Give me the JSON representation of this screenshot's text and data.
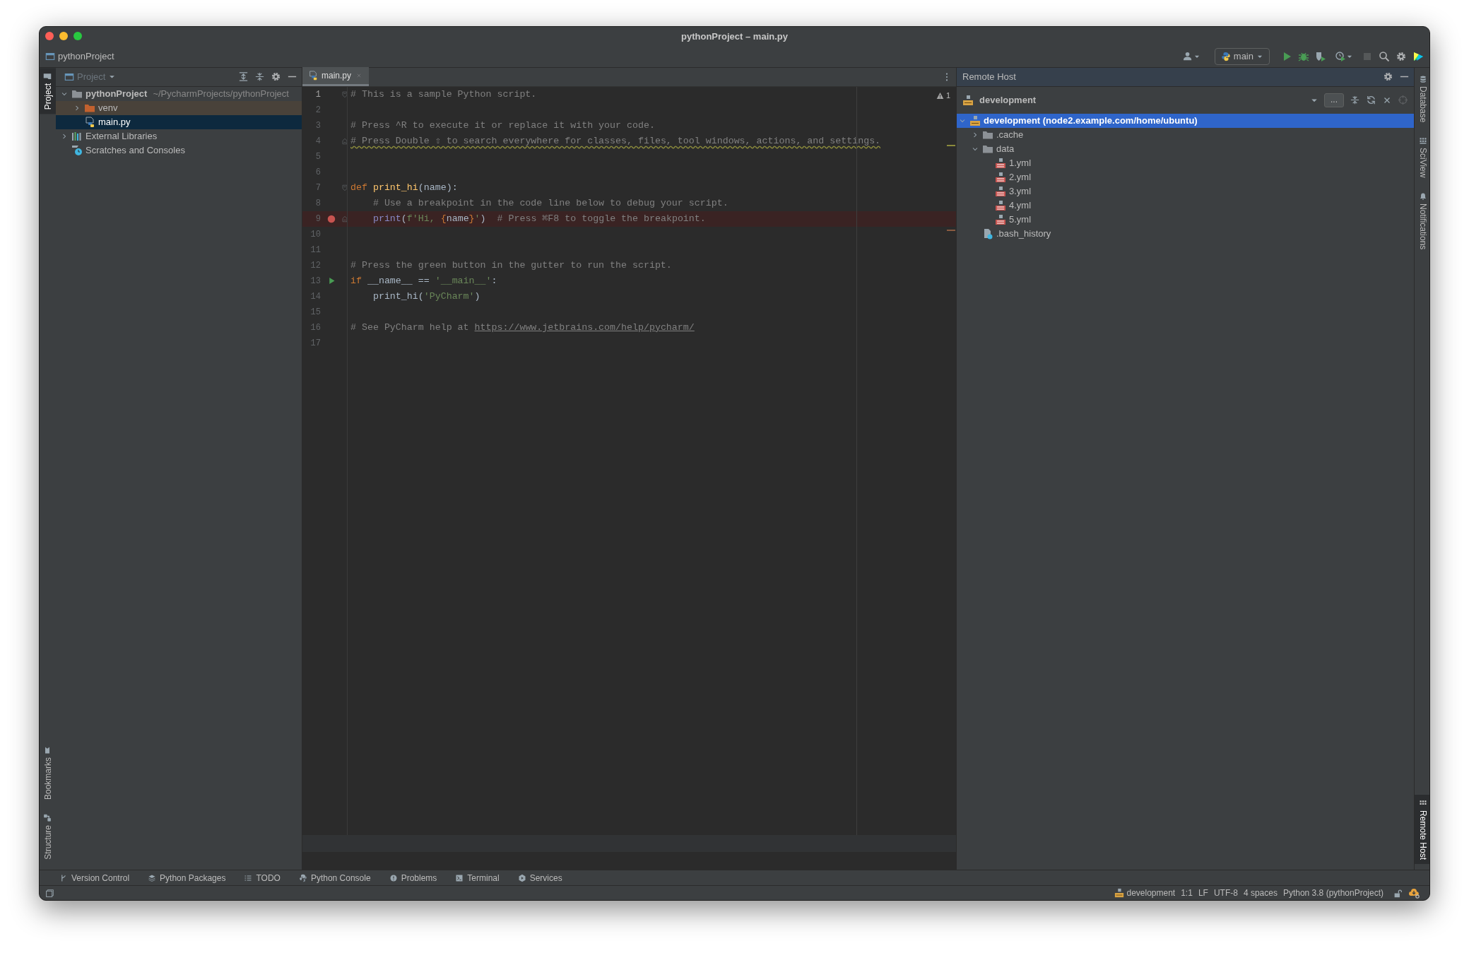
{
  "window": {
    "title": "pythonProject – main.py"
  },
  "navigation_bar": {
    "breadcrumb": "pythonProject",
    "run_configuration": "main",
    "stop_disabled": true
  },
  "left_stripe": {
    "top": [
      {
        "label": "Project",
        "selected": true
      }
    ],
    "bottom": [
      {
        "label": "Bookmarks",
        "selected": false
      },
      {
        "label": "Structure",
        "selected": false
      }
    ]
  },
  "project_panel": {
    "title": "Project",
    "tree": [
      {
        "label": "pythonProject",
        "detail": "~/PycharmProjects/pythonProject",
        "kind": "project_root",
        "expanded": true,
        "selected": false,
        "children": [
          {
            "label": "venv",
            "kind": "excluded_folder",
            "expanded": false,
            "selected": false
          },
          {
            "label": "main.py",
            "kind": "python_file",
            "selected": true
          }
        ]
      },
      {
        "label": "External Libraries",
        "kind": "libraries",
        "expanded": false,
        "selected": false
      },
      {
        "label": "Scratches and Consoles",
        "kind": "scratches",
        "selected": false
      }
    ]
  },
  "editor": {
    "tabs": [
      {
        "label": "main.py",
        "selected": true
      }
    ],
    "warning_count": "1",
    "lines": [
      {
        "number": "1",
        "breakpoint": false,
        "run_marker": false,
        "typo": false,
        "fold_start": true,
        "fold_end": false,
        "tokens": [
          {
            "kind": "comment",
            "text": "# This is a sample Python script."
          }
        ]
      },
      {
        "number": "2",
        "breakpoint": false,
        "run_marker": false,
        "typo": false,
        "fold_start": false,
        "fold_end": false
      },
      {
        "number": "3",
        "breakpoint": false,
        "run_marker": false,
        "typo": false,
        "fold_start": false,
        "fold_end": false,
        "tokens": [
          {
            "kind": "comment",
            "text": "# Press ^R to execute it or replace it with your code."
          }
        ]
      },
      {
        "number": "4",
        "breakpoint": false,
        "run_marker": false,
        "typo": true,
        "fold_start": false,
        "fold_end": true,
        "tokens": [
          {
            "kind": "comment",
            "text": "# Press Double ⇧ to search everywhere for classes, files, tool windows, actions, and settings."
          }
        ]
      },
      {
        "number": "5",
        "breakpoint": false,
        "run_marker": false,
        "typo": false,
        "fold_start": false,
        "fold_end": false
      },
      {
        "number": "6",
        "breakpoint": false,
        "run_marker": false,
        "typo": false,
        "fold_start": false,
        "fold_end": false
      },
      {
        "number": "7",
        "breakpoint": false,
        "run_marker": false,
        "typo": false,
        "fold_start": true,
        "fold_end": false,
        "tokens": [
          {
            "kind": "keyword",
            "text": "def "
          },
          {
            "kind": "function",
            "text": "print_hi"
          },
          {
            "kind": "plain",
            "text": "(name):"
          }
        ]
      },
      {
        "number": "8",
        "breakpoint": false,
        "run_marker": false,
        "typo": false,
        "fold_start": false,
        "fold_end": false,
        "tokens": [
          {
            "kind": "comment",
            "text": "    # Use a breakpoint in the code line below to debug your script."
          }
        ]
      },
      {
        "number": "9",
        "breakpoint": true,
        "run_marker": false,
        "typo": false,
        "fold_start": false,
        "fold_end": true,
        "tokens": [
          {
            "kind": "builtin",
            "text": "    print"
          },
          {
            "kind": "plain",
            "text": "("
          },
          {
            "kind": "string",
            "text": "f'Hi, "
          },
          {
            "kind": "brace",
            "text": "{"
          },
          {
            "kind": "plain",
            "text": "name"
          },
          {
            "kind": "brace",
            "text": "}"
          },
          {
            "kind": "string",
            "text": "'"
          },
          {
            "kind": "plain",
            "text": ")"
          },
          {
            "kind": "comment",
            "text": "  # Press ⌘F8 to toggle the breakpoint."
          }
        ]
      },
      {
        "number": "10",
        "breakpoint": false,
        "run_marker": false,
        "typo": false,
        "fold_start": false,
        "fold_end": false
      },
      {
        "number": "11",
        "breakpoint": false,
        "run_marker": false,
        "typo": false,
        "fold_start": false,
        "fold_end": false
      },
      {
        "number": "12",
        "breakpoint": false,
        "run_marker": false,
        "typo": false,
        "fold_start": false,
        "fold_end": false,
        "tokens": [
          {
            "kind": "comment",
            "text": "# Press the green button in the gutter to run the script."
          }
        ]
      },
      {
        "number": "13",
        "breakpoint": false,
        "run_marker": true,
        "typo": false,
        "fold_start": false,
        "fold_end": false,
        "tokens": [
          {
            "kind": "keyword",
            "text": "if"
          },
          {
            "kind": "plain",
            "text": " __name__ == "
          },
          {
            "kind": "string",
            "text": "'__main__'"
          },
          {
            "kind": "plain",
            "text": ":"
          }
        ]
      },
      {
        "number": "14",
        "breakpoint": false,
        "run_marker": false,
        "typo": false,
        "fold_start": false,
        "fold_end": false,
        "tokens": [
          {
            "kind": "plain",
            "text": "    print_hi("
          },
          {
            "kind": "string",
            "text": "'PyCharm'"
          },
          {
            "kind": "plain",
            "text": ")"
          }
        ]
      },
      {
        "number": "15",
        "breakpoint": false,
        "run_marker": false,
        "typo": false,
        "fold_start": false,
        "fold_end": false
      },
      {
        "number": "16",
        "breakpoint": false,
        "run_marker": false,
        "typo": false,
        "fold_start": false,
        "fold_end": false,
        "tokens": [
          {
            "kind": "comment",
            "text": "# See PyCharm help at "
          },
          {
            "kind": "link",
            "text": "https://www.jetbrains.com/help/pycharm/"
          }
        ]
      },
      {
        "number": "17",
        "breakpoint": false,
        "run_marker": false,
        "typo": false,
        "fold_start": false,
        "fold_end": false
      }
    ]
  },
  "remote_host": {
    "title": "Remote Host",
    "server": "development",
    "more_button": "...",
    "tree": [
      {
        "label": "development (node2.example.com/home/ubuntu)",
        "kind": "sftp_root",
        "expanded": true,
        "selected": true,
        "children": [
          {
            "label": ".cache",
            "kind": "folder",
            "expanded": false,
            "selected": false
          },
          {
            "label": "data",
            "kind": "folder",
            "expanded": true,
            "selected": false,
            "children": [
              {
                "label": "1.yml",
                "kind": "yml",
                "selected": false
              },
              {
                "label": "2.yml",
                "kind": "yml",
                "selected": false
              },
              {
                "label": "3.yml",
                "kind": "yml",
                "selected": false
              },
              {
                "label": "4.yml",
                "kind": "yml",
                "selected": false
              },
              {
                "label": "5.yml",
                "kind": "yml",
                "selected": false
              }
            ]
          },
          {
            "label": ".bash_history",
            "kind": "unknown_file",
            "selected": false
          }
        ]
      }
    ]
  },
  "right_stripe": {
    "top": [
      {
        "label": "Database",
        "kind": "database",
        "selected": false
      },
      {
        "label": "SciView",
        "kind": "sciview",
        "selected": false
      },
      {
        "label": "Notifications",
        "kind": "bell",
        "selected": false
      }
    ],
    "bottom": [
      {
        "label": "Remote Host",
        "kind": "remote",
        "selected": true
      }
    ]
  },
  "tool_windows": [
    {
      "label": "Version Control",
      "kind": "branch"
    },
    {
      "label": "Python Packages",
      "kind": "layers"
    },
    {
      "label": "TODO",
      "kind": "list"
    },
    {
      "label": "Python Console",
      "kind": "python"
    },
    {
      "label": "Problems",
      "kind": "problems"
    },
    {
      "label": "Terminal",
      "kind": "terminal"
    },
    {
      "label": "Services",
      "kind": "services"
    }
  ],
  "status_bar": {
    "items": [
      {
        "text": "development",
        "kind": "server"
      },
      {
        "text": "1:1",
        "kind": "text"
      },
      {
        "text": "LF",
        "kind": "text"
      },
      {
        "text": "UTF-8",
        "kind": "text"
      },
      {
        "text": "4 spaces",
        "kind": "text"
      },
      {
        "text": "Python 3.8 (pythonProject)",
        "kind": "text"
      }
    ]
  }
}
